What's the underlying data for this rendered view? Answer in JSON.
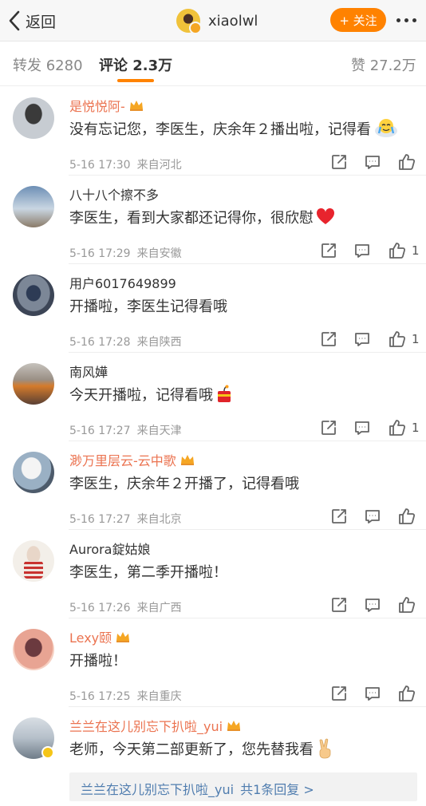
{
  "header": {
    "back_label": "返回",
    "username": "xiaolwl",
    "follow_label": "+ 关注"
  },
  "tabs": [
    {
      "label": "转发 6280"
    },
    {
      "label": "评论 2.3万"
    },
    {
      "label": "赞 27.2万"
    }
  ],
  "comments": [
    {
      "name": "是悦悦阿-",
      "text": "没有忘记您，李医生，庆余年２播出啦，记得看",
      "time": "5-16 17:30",
      "location": "来自河北",
      "likes": ""
    },
    {
      "name": "八十八个擦不多",
      "text": "李医生，看到大家都还记得你，很欣慰",
      "time": "5-16 17:29",
      "location": "来自安徽",
      "likes": "1"
    },
    {
      "name": "用户6017649899",
      "text": "开播啦，李医生记得看哦",
      "time": "5-16 17:28",
      "location": "来自陕西",
      "likes": "1"
    },
    {
      "name": "南风嬅",
      "text": "今天开播啦，记得看哦",
      "time": "5-16 17:27",
      "location": "来自天津",
      "likes": "1"
    },
    {
      "name": "渺万里层云-云中歌",
      "text": "李医生，庆余年２开播了，记得看哦",
      "time": "5-16 17:27",
      "location": "来自北京",
      "likes": ""
    },
    {
      "name": "Aurora錠姑娘",
      "text": "李医生，第二季开播啦！",
      "time": "5-16 17:26",
      "location": "来自广西",
      "likes": ""
    },
    {
      "name": "Lexy颐",
      "text": "开播啦！",
      "time": "5-16 17:25",
      "location": "来自重庆",
      "likes": ""
    },
    {
      "name": "兰兰在这儿别忘下扒啦_yui",
      "text": "老师，今天第二部更新了，您先替我看",
      "time": "",
      "location": "",
      "likes": ""
    }
  ],
  "reply": {
    "name": "兰兰在这儿别忘下扒啦_yui",
    "count_text": "共1条回复 >"
  },
  "colors": {
    "accent": "#ff8200",
    "vip_name": "#eb7350",
    "link": "#507daf"
  },
  "icons": [
    "chevron-left-icon",
    "more-icon",
    "share-icon",
    "comment-icon",
    "like-icon",
    "crown-icon",
    "heart-emoji",
    "firecracker-emoji",
    "crying-emoji",
    "victory-hand-emoji"
  ]
}
